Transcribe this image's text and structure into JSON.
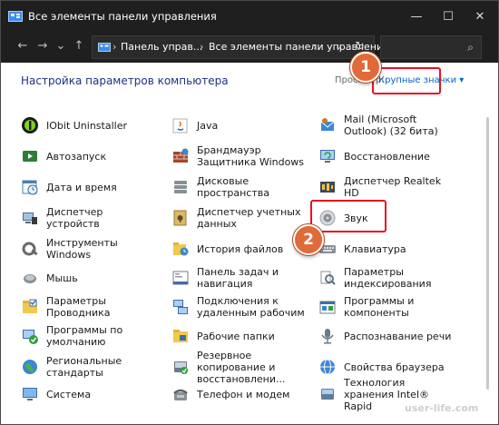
{
  "window": {
    "title": "Все элементы панели управления",
    "controls": {
      "minimize": "—",
      "maximize": "☐",
      "close": "✕"
    }
  },
  "nav": {
    "back": "←",
    "forward": "→",
    "dropdown": "⌄",
    "up": "↑",
    "breadcrumb": [
      "Панель управ...",
      "Все элементы панели управления"
    ],
    "separator": "›",
    "address_chevron": "⌄",
    "refresh": "↻",
    "search_icon": "⌕",
    "search_placeholder": ""
  },
  "content": {
    "heading": "Настройка параметров компьютера",
    "view_label": "Просмотр:",
    "view_value": "Крупные значки ▾"
  },
  "items": {
    "col1": [
      {
        "label": "IObit Uninstaller",
        "icon": "iobit-uninstaller-icon"
      },
      {
        "label": "Автозапуск",
        "icon": "autoplay-icon"
      },
      {
        "label": "Дата и время",
        "icon": "date-time-icon"
      },
      {
        "label": "Диспетчер устройств",
        "icon": "device-manager-icon"
      },
      {
        "label": "Инструменты Windows",
        "icon": "windows-tools-icon"
      },
      {
        "label": "Мышь",
        "icon": "mouse-icon"
      },
      {
        "label": "Параметры Проводника",
        "icon": "explorer-options-icon"
      },
      {
        "label": "Программы по умолчанию",
        "icon": "default-programs-icon"
      },
      {
        "label": "Региональные стандарты",
        "icon": "region-icon"
      },
      {
        "label": "Система",
        "icon": "system-icon"
      }
    ],
    "col2": [
      {
        "label": "Java",
        "icon": "java-icon"
      },
      {
        "label": "Брандмауэр Защитника Windows",
        "icon": "firewall-icon"
      },
      {
        "label": "Дисковые пространства",
        "icon": "storage-spaces-icon"
      },
      {
        "label": "Диспетчер учетных данных",
        "icon": "credential-manager-icon"
      },
      {
        "label": "История файлов",
        "icon": "file-history-icon"
      },
      {
        "label": "Панель задач и навигация",
        "icon": "taskbar-icon"
      },
      {
        "label": "Подключения к удаленным рабочим",
        "icon": "remote-connections-icon"
      },
      {
        "label": "Рабочие папки",
        "icon": "work-folders-icon"
      },
      {
        "label": "Резервное копирование и восстановлени...",
        "icon": "backup-icon"
      },
      {
        "label": "Телефон и модем",
        "icon": "phone-modem-icon"
      }
    ],
    "col3": [
      {
        "label": "Mail (Microsoft Outlook) (32 бита)",
        "icon": "mail-icon"
      },
      {
        "label": "Восстановление",
        "icon": "recovery-icon"
      },
      {
        "label": "Диспетчер Realtek HD",
        "icon": "realtek-icon"
      },
      {
        "label": "Звук",
        "icon": "sound-icon"
      },
      {
        "label": "Клавиатура",
        "icon": "keyboard-icon"
      },
      {
        "label": "Параметры индексирования",
        "icon": "indexing-icon"
      },
      {
        "label": "Программы и компоненты",
        "icon": "programs-features-icon"
      },
      {
        "label": "Распознавание речи",
        "icon": "speech-recognition-icon"
      },
      {
        "label": "Свойства браузера",
        "icon": "browser-properties-icon"
      },
      {
        "label": "Технология хранения Intel® Rapid",
        "icon": "intel-rst-icon"
      }
    ]
  },
  "callouts": {
    "badge1": "1",
    "badge2": "2"
  },
  "watermark": "user-life.com",
  "colors": {
    "titlebar": "#1f1f1f",
    "heading": "#1e3287",
    "accent": "#0066cc",
    "highlight": "#e81123",
    "badge": "#e06a39"
  }
}
